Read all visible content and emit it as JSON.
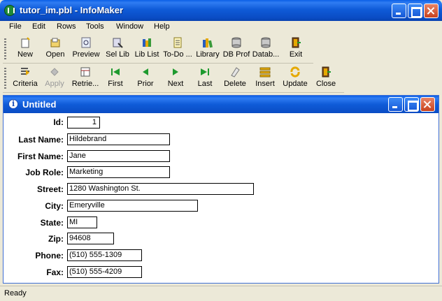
{
  "window": {
    "title": "tutor_im.pbl - InfoMaker"
  },
  "menu": [
    "File",
    "Edit",
    "Rows",
    "Tools",
    "Window",
    "Help"
  ],
  "toolbar1": [
    {
      "label": "New",
      "icon": "new-icon"
    },
    {
      "label": "Open",
      "icon": "open-icon"
    },
    {
      "label": "Preview",
      "icon": "preview-icon"
    },
    {
      "label": "Sel Lib",
      "icon": "select-library-icon"
    },
    {
      "label": "Lib List",
      "icon": "library-list-icon"
    },
    {
      "label": "To-Do ...",
      "icon": "todo-list-icon"
    },
    {
      "label": "Library",
      "icon": "library-icon"
    },
    {
      "label": "DB Prof",
      "icon": "database-profile-icon"
    },
    {
      "label": "Datab...",
      "icon": "database-icon"
    },
    {
      "label": "Exit",
      "icon": "exit-icon"
    }
  ],
  "toolbar2": [
    {
      "label": "Criteria",
      "icon": "criteria-icon",
      "enabled": true
    },
    {
      "label": "Apply",
      "icon": "apply-icon",
      "enabled": false
    },
    {
      "label": "Retrie...",
      "icon": "retrieve-icon",
      "enabled": true
    },
    {
      "label": "First",
      "icon": "first-record-icon",
      "enabled": true
    },
    {
      "label": "Prior",
      "icon": "prior-record-icon",
      "enabled": true
    },
    {
      "label": "Next",
      "icon": "next-record-icon",
      "enabled": true
    },
    {
      "label": "Last",
      "icon": "last-record-icon",
      "enabled": true
    },
    {
      "label": "Delete",
      "icon": "delete-icon",
      "enabled": true
    },
    {
      "label": "Insert",
      "icon": "insert-icon",
      "enabled": true
    },
    {
      "label": "Update",
      "icon": "update-icon",
      "enabled": true
    },
    {
      "label": "Close",
      "icon": "close-door-icon",
      "enabled": true
    }
  ],
  "child_window": {
    "title": "Untitled"
  },
  "form": {
    "id": {
      "label": "Id:",
      "value": "1"
    },
    "last_name": {
      "label": "Last Name:",
      "value": "Hildebrand"
    },
    "first_name": {
      "label": "First Name:",
      "value": "Jane"
    },
    "job_role": {
      "label": "Job Role:",
      "value": "Marketing"
    },
    "street": {
      "label": "Street:",
      "value": "1280 Washington St."
    },
    "city": {
      "label": "City:",
      "value": "Emeryville"
    },
    "state": {
      "label": "State:",
      "value": "MI"
    },
    "zip": {
      "label": "Zip:",
      "value": "94608"
    },
    "phone": {
      "label": "Phone:",
      "value": "(510) 555-1309"
    },
    "fax": {
      "label": "Fax:",
      "value": "(510) 555-4209"
    }
  },
  "status": {
    "text": "Ready"
  },
  "colors": {
    "title_blue": "#0a4cc4",
    "close_red": "#c8421e",
    "face": "#ece9d8",
    "play_green": "#1e9a2e"
  }
}
